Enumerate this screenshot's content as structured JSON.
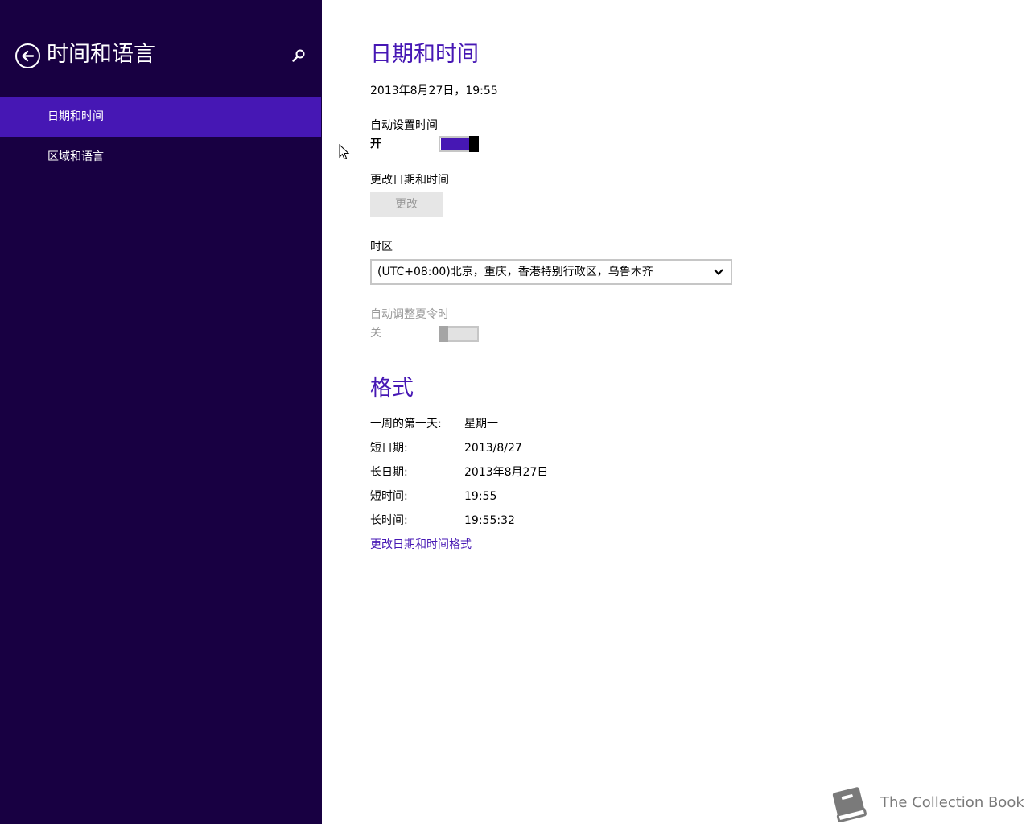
{
  "sidebar": {
    "title": "时间和语言",
    "items": [
      {
        "label": "日期和时间",
        "selected": true
      },
      {
        "label": "区域和语言",
        "selected": false
      }
    ]
  },
  "main": {
    "heading": "日期和时间",
    "current_datetime": "2013年8月27日，19:55",
    "auto_time": {
      "label": "自动设置时间",
      "state_label": "开",
      "on": true
    },
    "change_datetime": {
      "label": "更改日期和时间",
      "button_label": "更改"
    },
    "timezone": {
      "label": "时区",
      "value": "(UTC+08:00)北京，重庆，香港特别行政区，乌鲁木齐"
    },
    "dst": {
      "label": "自动调整夏令时",
      "state_label": "关",
      "on": false
    },
    "format": {
      "heading": "格式",
      "rows": [
        {
          "label": "一周的第一天:",
          "value": "星期一"
        },
        {
          "label": "短日期:",
          "value": "2013/8/27"
        },
        {
          "label": "长日期:",
          "value": "2013年8月27日"
        },
        {
          "label": "短时间:",
          "value": "19:55"
        },
        {
          "label": "长时间:",
          "value": "19:55:32"
        }
      ],
      "link": "更改日期和时间格式"
    }
  },
  "watermark": {
    "text": "The Collection Book"
  },
  "colors": {
    "sidebar_bg": "#180042",
    "accent": "#4617b4"
  }
}
